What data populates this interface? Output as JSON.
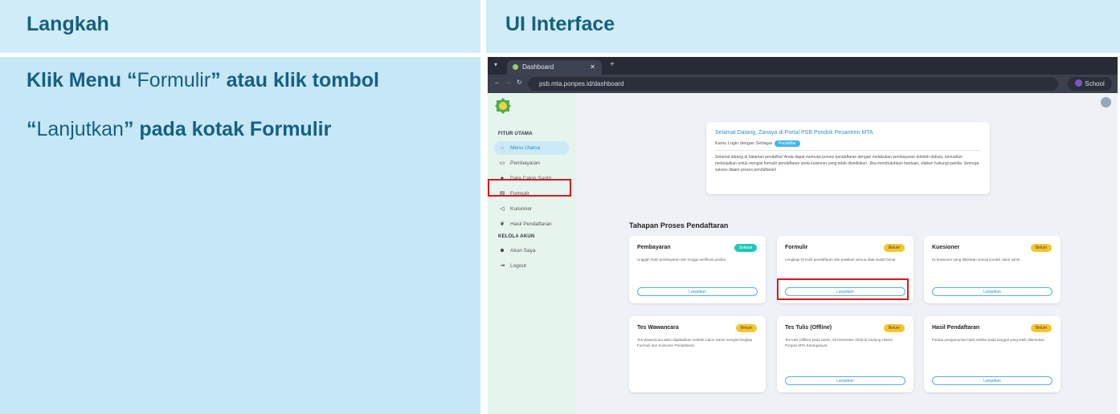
{
  "headers": {
    "left": "Langkah",
    "right": "UI Interface"
  },
  "step": {
    "line1": [
      {
        "text": "Klik Menu “",
        "bold": true
      },
      {
        "text": "Formulir",
        "bold": false
      },
      {
        "text": "” atau klik tombol",
        "bold": true
      }
    ],
    "line2": [
      {
        "text": "“",
        "bold": true
      },
      {
        "text": "Lanjutkan",
        "bold": false
      },
      {
        "text": "” pada kotak Formulir",
        "bold": true
      }
    ]
  },
  "browser": {
    "tab_title": "Dashboard",
    "url": "psb.mta.ponpes.id/dashboard",
    "profile": "School"
  },
  "sidebar": {
    "section1": "FITUR UTAMA",
    "items": [
      {
        "label": "Menu Utama",
        "icon": "home-icon"
      },
      {
        "label": "Pembayaran",
        "icon": "card-icon"
      },
      {
        "label": "Data Calon Santri",
        "icon": "user-icon"
      },
      {
        "label": "Formulir",
        "icon": "form-icon"
      },
      {
        "label": "Kuisioner",
        "icon": "megaphone-icon"
      },
      {
        "label": "Hasil Pendaftaran",
        "icon": "users-icon"
      }
    ],
    "section2": "KELOLA AKUN",
    "items2": [
      {
        "label": "Akun Saya",
        "icon": "user-gear-icon"
      },
      {
        "label": "Logout",
        "icon": "logout-icon"
      }
    ]
  },
  "welcome": {
    "title": "Selamat Datang, Zanaya di Portal PSB Pondok Pesantren MTA",
    "login_as": "Kamu Login dengan Sebagai",
    "role": "Pendaftar",
    "text": "Selamat datang di halaman pendaftar! Anda dapat memulai proses pendaftaran dengan melakukan pembayaran terlebih dahulu, kemudian melanjutkan untuk mengisi formulir pendaftaran serta kuisioner yang telah disediakan. Jika membutuhkan bantuan, silakan hubungi panitia. Semoga sukses dalam proses pendaftaran!"
  },
  "section_title": "Tahapan Proses Pendaftaran",
  "cards": [
    {
      "title": "Pembayaran",
      "status": "Selesai",
      "done": true,
      "desc": "Unggah bukti pembayaran dan tunggu verifikasi panitia.",
      "button": "Lanjutkan"
    },
    {
      "title": "Formulir",
      "status": "Belum",
      "done": false,
      "desc": "Lengkapi formulir pendaftaran dan pastikan semua data sudah benar.",
      "button": "Lanjutkan"
    },
    {
      "title": "Kuesioner",
      "status": "Belum",
      "done": false,
      "desc": "Isi kuesioner yang diberikan sesuai kondisi calon santri.",
      "button": "Lanjutkan"
    },
    {
      "title": "Tes Wawancara",
      "status": "Belum",
      "done": false,
      "desc": "Tes Wawancara akan dijadwalkan setelah Calon Santri mengisi lengkap Formulir dan Kuisioner Pendaftaran.",
      "button": ""
    },
    {
      "title": "Tes Tulis (Offline)",
      "status": "Belum",
      "done": false,
      "desc": "Tes tulis (offline) pada Senin, 29 Desember 2025 di Gedung Utama Ponpes MTA Karanganyar.",
      "button": "Lanjutkan"
    },
    {
      "title": "Hasil Pendaftaran",
      "status": "Belum",
      "done": false,
      "desc": "Pantau pengumuman hasil seleksi pada tanggal yang telah ditentukan.",
      "button": "Lanjutkan"
    }
  ]
}
